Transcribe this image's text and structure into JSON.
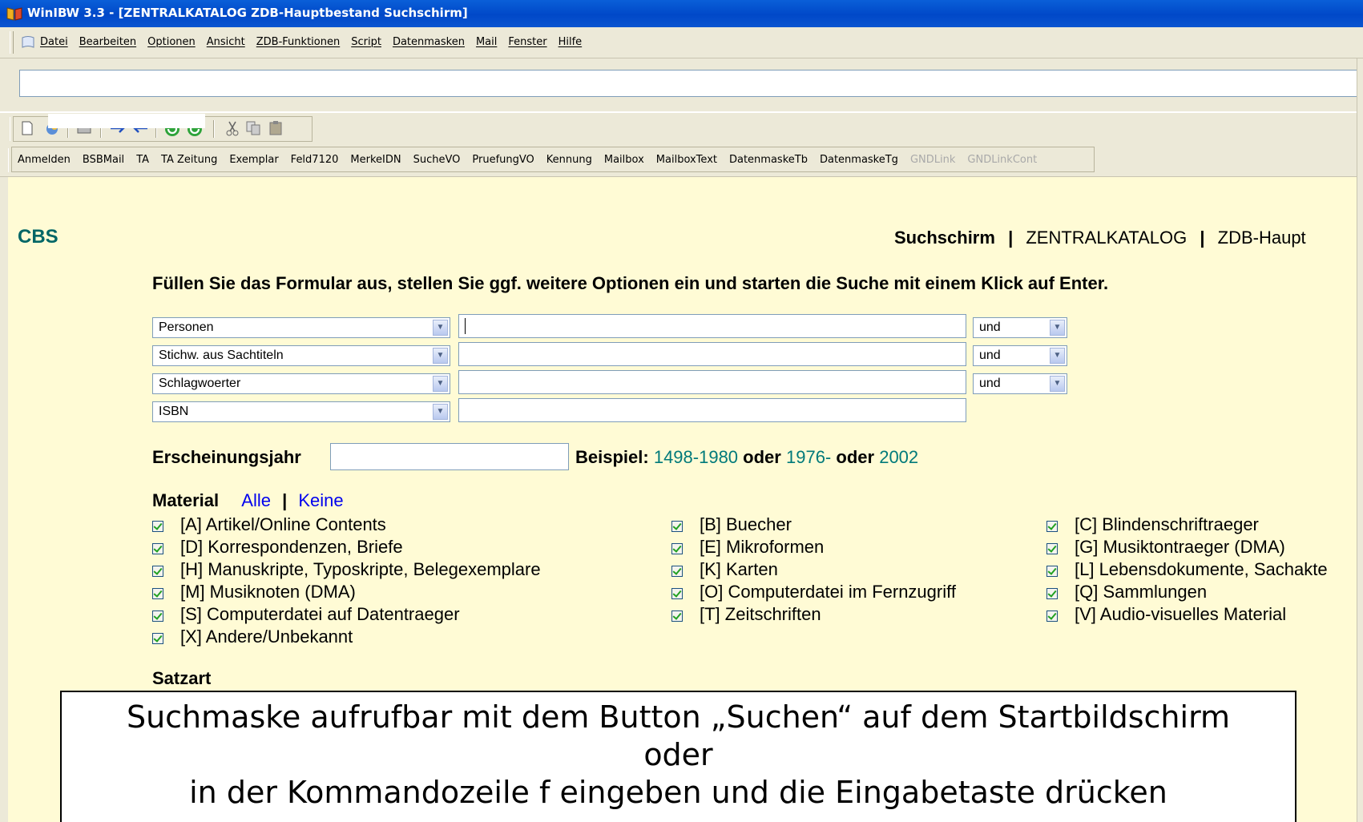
{
  "window": {
    "title": "WinIBW 3.3 - [ZENTRALKATALOG ZDB-Hauptbestand Suchschirm]"
  },
  "menu": [
    "Datei",
    "Bearbeiten",
    "Optionen",
    "Ansicht",
    "ZDB-Funktionen",
    "Script",
    "Datenmasken",
    "Mail",
    "Fenster",
    "Hilfe"
  ],
  "command_line": {
    "value": ""
  },
  "toolbar_icons": [
    "new-document-icon",
    "open-icon",
    "print-icon",
    "forward-arrow-icon",
    "back-arrow-icon",
    "refresh-green-icon",
    "redo-green-icon",
    "cut-icon",
    "copy-icon",
    "paste-icon"
  ],
  "button_bar": [
    {
      "label": "Anmelden",
      "enabled": true
    },
    {
      "label": "BSBMail",
      "enabled": true
    },
    {
      "label": "TA",
      "enabled": true
    },
    {
      "label": "TA Zeitung",
      "enabled": true
    },
    {
      "label": "Exemplar",
      "enabled": true
    },
    {
      "label": "Feld7120",
      "enabled": true
    },
    {
      "label": "MerkeIDN",
      "enabled": true
    },
    {
      "label": "SucheVO",
      "enabled": true
    },
    {
      "label": "PruefungVO",
      "enabled": true
    },
    {
      "label": "Kennung",
      "enabled": true
    },
    {
      "label": "Mailbox",
      "enabled": true
    },
    {
      "label": "MailboxText",
      "enabled": true
    },
    {
      "label": "DatenmaskeTb",
      "enabled": true
    },
    {
      "label": "DatenmaskeTg",
      "enabled": true
    },
    {
      "label": "GNDLink",
      "enabled": false
    },
    {
      "label": "GNDLinkCont",
      "enabled": false
    }
  ],
  "header": {
    "brand": "CBS",
    "crumb_active": "Suchschirm",
    "separator": "|",
    "crumb_catalog": "ZENTRALKATALOG",
    "crumb_db": "ZDB-Haupt"
  },
  "instruction": "Füllen Sie das Formular aus, stellen Sie ggf. weitere Optionen ein und starten die Suche mit einem Klick auf Enter.",
  "search_rows": [
    {
      "field": "Personen",
      "value": "",
      "operator": "und"
    },
    {
      "field": "Stichw. aus Sachtiteln",
      "value": "",
      "operator": "und"
    },
    {
      "field": "Schlagwoerter",
      "value": "",
      "operator": "und"
    },
    {
      "field": "ISBN",
      "value": ""
    }
  ],
  "year": {
    "label": "Erscheinungsjahr",
    "value": "",
    "example_label": "Beispiel:",
    "ex1": "1498-1980",
    "oder": "oder",
    "ex2": "1976-",
    "ex3": "2002"
  },
  "material": {
    "label": "Material",
    "all": "Alle",
    "sep": "|",
    "none": "Keine",
    "items": [
      {
        "label": "[A] Artikel/Online Contents",
        "checked": true
      },
      {
        "label": "[B] Buecher",
        "checked": true
      },
      {
        "label": "[C] Blindenschriftraeger",
        "checked": true
      },
      {
        "label": "[D] Korrespondenzen, Briefe",
        "checked": true
      },
      {
        "label": "[E] Mikroformen",
        "checked": true
      },
      {
        "label": "[G] Musiktontraeger (DMA)",
        "checked": true
      },
      {
        "label": "[H] Manuskripte, Typoskripte, Belegexemplare",
        "checked": true
      },
      {
        "label": "[K] Karten",
        "checked": true
      },
      {
        "label": "[L] Lebensdokumente, Sachakte",
        "checked": true
      },
      {
        "label": "[M] Musiknoten (DMA)",
        "checked": true
      },
      {
        "label": "[O] Computerdatei im Fernzugriff",
        "checked": true
      },
      {
        "label": "[Q] Sammlungen",
        "checked": true
      },
      {
        "label": "[S] Computerdatei auf Datentraeger",
        "checked": true
      },
      {
        "label": "[T] Zeitschriften",
        "checked": true
      },
      {
        "label": "[V] Audio-visuelles Material",
        "checked": true
      },
      {
        "label": "[X] Andere/Unbekannt",
        "checked": true
      }
    ]
  },
  "satzart": {
    "label": "Satzart"
  },
  "callout": {
    "line1": "Suchmaske aufrufbar mit dem Button „Suchen“ auf dem Startbildschirm",
    "line2": "oder",
    "line3": "in der Kommandozeile f eingeben und die Eingabetaste drücken"
  }
}
